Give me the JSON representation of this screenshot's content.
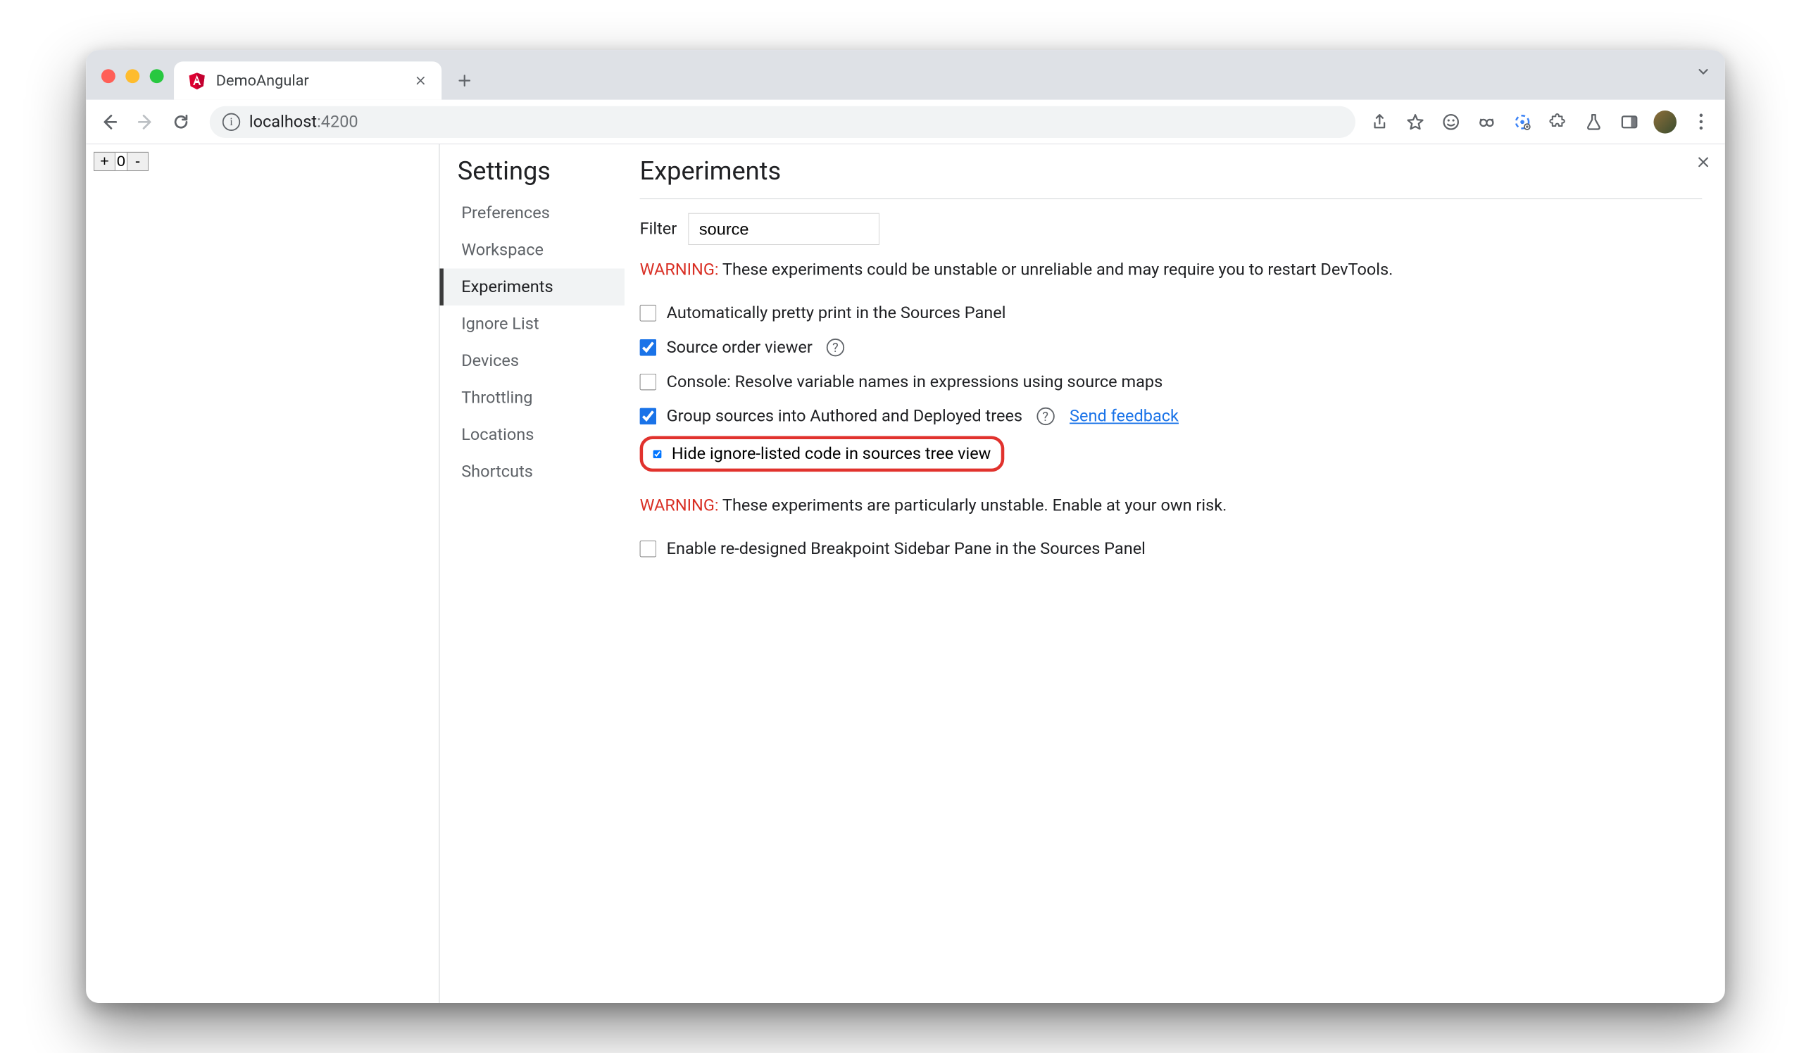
{
  "tab": {
    "title": "DemoAngular"
  },
  "url": {
    "host": "localhost",
    "port": ":4200"
  },
  "page": {
    "counter_value": "0",
    "plus": "+",
    "minus": "-"
  },
  "sidebar": {
    "heading": "Settings",
    "items": [
      {
        "label": "Preferences",
        "active": false
      },
      {
        "label": "Workspace",
        "active": false
      },
      {
        "label": "Experiments",
        "active": true
      },
      {
        "label": "Ignore List",
        "active": false
      },
      {
        "label": "Devices",
        "active": false
      },
      {
        "label": "Throttling",
        "active": false
      },
      {
        "label": "Locations",
        "active": false
      },
      {
        "label": "Shortcuts",
        "active": false
      }
    ]
  },
  "main": {
    "heading": "Experiments",
    "filter_label": "Filter",
    "filter_value": "source",
    "warning1_prefix": "WARNING:",
    "warning1_text": " These experiments could be unstable or unreliable and may require you to restart DevTools.",
    "warning2_prefix": "WARNING:",
    "warning2_text": " These experiments are particularly unstable. Enable at your own risk.",
    "feedback_link": "Send feedback",
    "experiments": [
      {
        "label": "Automatically pretty print in the Sources Panel",
        "checked": false,
        "help": false,
        "link": false,
        "highlight": false
      },
      {
        "label": "Source order viewer",
        "checked": true,
        "help": true,
        "link": false,
        "highlight": false
      },
      {
        "label": "Console: Resolve variable names in expressions using source maps",
        "checked": false,
        "help": false,
        "link": false,
        "highlight": false
      },
      {
        "label": "Group sources into Authored and Deployed trees",
        "checked": true,
        "help": true,
        "link": true,
        "highlight": false
      },
      {
        "label": "Hide ignore-listed code in sources tree view",
        "checked": true,
        "help": false,
        "link": false,
        "highlight": true
      }
    ],
    "unstable_experiments": [
      {
        "label": "Enable re-designed Breakpoint Sidebar Pane in the Sources Panel",
        "checked": false
      }
    ]
  }
}
